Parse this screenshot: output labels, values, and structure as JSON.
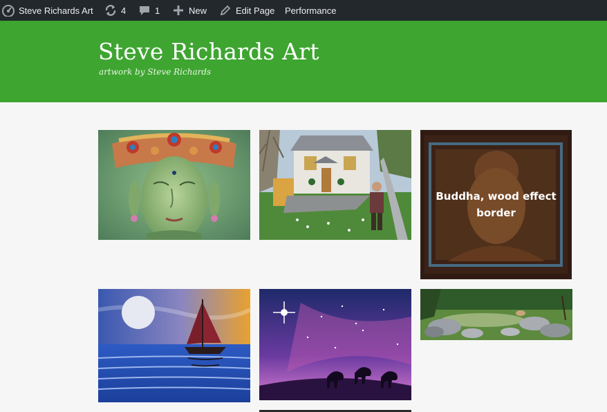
{
  "admin_bar": {
    "site_name": "Steve Richards Art",
    "updates_count": "4",
    "comments_count": "1",
    "new_label": "New",
    "edit_label": "Edit Page",
    "performance_label": "Performance"
  },
  "header": {
    "title": "Steve Richards Art",
    "description": "artwork by Steve Richards"
  },
  "gallery": {
    "items": [
      {
        "id": "green-buddha",
        "caption": ""
      },
      {
        "id": "cottage",
        "caption": ""
      },
      {
        "id": "buddha-wood",
        "caption": "Buddha, wood effect border"
      },
      {
        "id": "sailboat",
        "caption": ""
      },
      {
        "id": "three-kings",
        "caption": ""
      },
      {
        "id": "river-rocks",
        "caption": ""
      }
    ]
  },
  "colors": {
    "admin_bar": "#23282d",
    "header_green": "#3ea531",
    "page_bg": "#f6f6f6"
  }
}
